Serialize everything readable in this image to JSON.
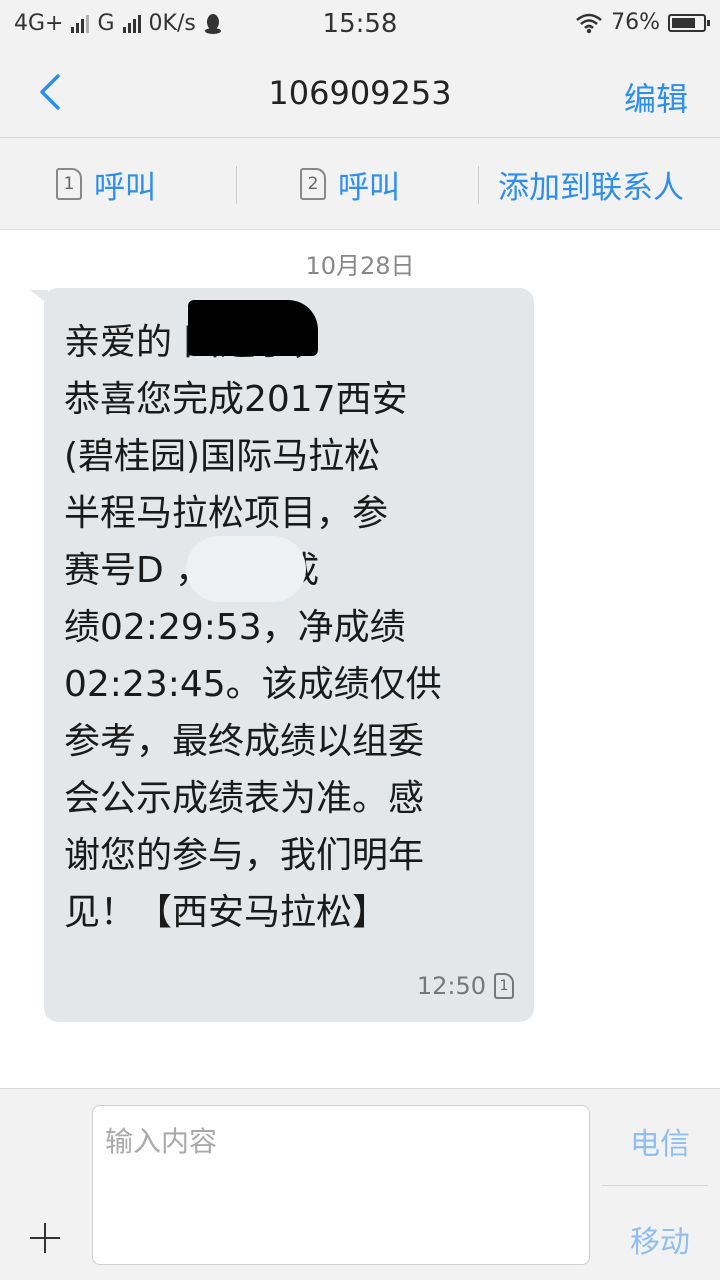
{
  "status_bar": {
    "network1": "4G+",
    "network2": "G",
    "speed": "0K/s",
    "time": "15:58",
    "battery": "76%",
    "battery_level": 0.76
  },
  "header": {
    "title": "106909253",
    "edit_label": "编辑"
  },
  "actions": {
    "call1_sim": "1",
    "call1_label": "呼叫",
    "call2_sim": "2",
    "call2_label": "呼叫",
    "add_contact_label": "添加到联系人"
  },
  "conversation": {
    "date": "10月28日",
    "message": {
      "text": "亲爱的        国选手，\n恭喜您完成2017西安\n(碧桂园)国际马拉松\n半程马拉松项目，参\n赛号D           ，枪声成\n绩02:29:53，净成绩\n02:23:45。该成绩仅供\n参考，最终成绩以组委\n会公示成绩表为准。感\n谢您的参与，我们明年\n见！【西安马拉松】",
      "time": "12:50",
      "sim": "1"
    }
  },
  "composer": {
    "placeholder": "输入内容",
    "send1_label": "电信",
    "send2_label": "移动"
  },
  "colors": {
    "accent": "#2b8ef0",
    "bubble": "#e3e7ea",
    "bar_bg": "#f2f2f2"
  }
}
